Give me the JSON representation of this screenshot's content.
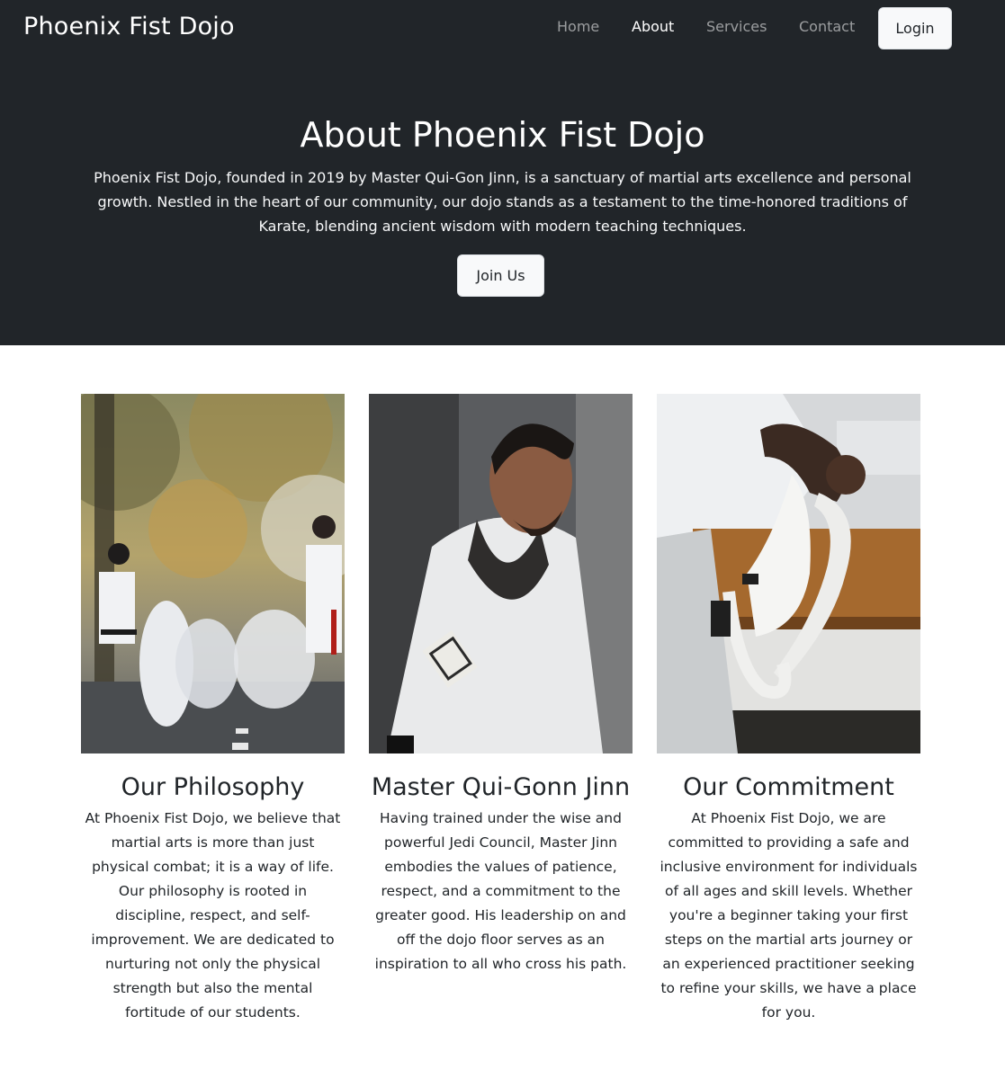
{
  "nav": {
    "brand": "Phoenix Fist Dojo",
    "links": [
      "Home",
      "About",
      "Services",
      "Contact"
    ],
    "active": "About",
    "login_label": "Login"
  },
  "hero": {
    "title": "About Phoenix Fist Dojo",
    "text": "Phoenix Fist Dojo, founded in 2019 by Master Qui-Gon Jinn, is a sanctuary of martial arts excellence and personal growth. Nestled in the heart of our community, our dojo stands as a testament to the time-honored traditions of Karate, blending ancient wisdom with modern teaching techniques.",
    "button_label": "Join Us"
  },
  "cards": [
    {
      "title": "Our Philosophy",
      "text": "At Phoenix Fist Dojo, we believe that martial arts is more than just physical combat; it is a way of life. Our philosophy is rooted in discipline, respect, and self-improvement. We are dedicated to nurturing not only the physical strength but also the mental fortitude of our students.",
      "image": "karate-class-photo"
    },
    {
      "title": "Master Qui-Gonn Jinn",
      "text": "Having trained under the wise and powerful Jedi Council, Master Jinn embodies the values of patience, respect, and a commitment to the greater good. His leadership on and off the dojo floor serves as an inspiration to all who cross his path.",
      "image": "master-portrait-photo"
    },
    {
      "title": "Our Commitment",
      "text": "At Phoenix Fist Dojo, we are committed to providing a safe and inclusive environment for individuals of all ages and skill levels. Whether you're a beginner taking your first steps on the martial arts journey or an experienced practitioner seeking to refine your skills, we have a place for you.",
      "image": "white-belt-photo"
    }
  ],
  "colors": {
    "dark": "#212529",
    "light": "#f8f9fa"
  }
}
